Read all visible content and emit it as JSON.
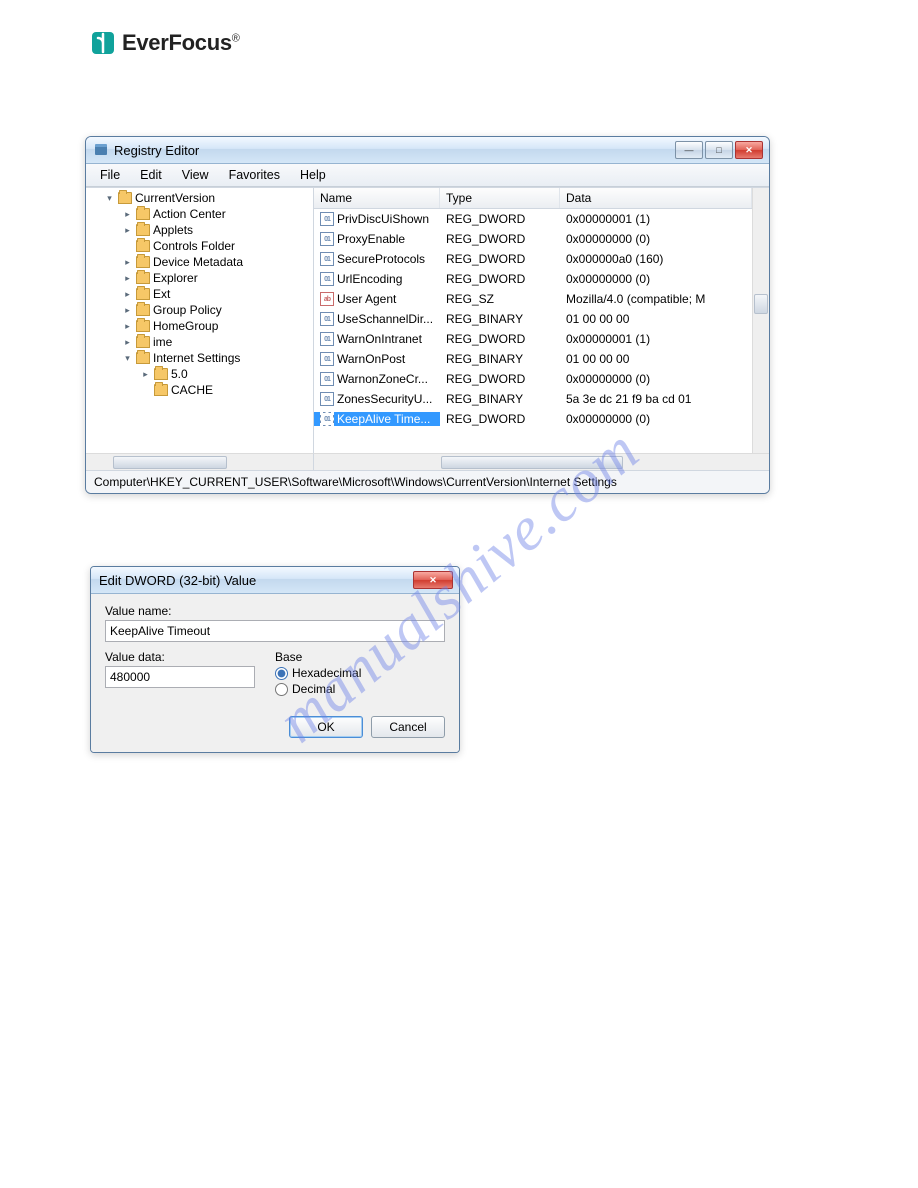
{
  "logo_text": "EverFocus",
  "watermark": "manualshive.com",
  "regedit": {
    "title": "Registry Editor",
    "menu": [
      "File",
      "Edit",
      "View",
      "Favorites",
      "Help"
    ],
    "status_path": "Computer\\HKEY_CURRENT_USER\\Software\\Microsoft\\Windows\\CurrentVersion\\Internet Settings",
    "tree": [
      {
        "indent": 0,
        "exp": "▾",
        "label": "CurrentVersion",
        "selected": false
      },
      {
        "indent": 1,
        "exp": "▸",
        "label": "Action Center"
      },
      {
        "indent": 1,
        "exp": "▸",
        "label": "Applets"
      },
      {
        "indent": 1,
        "exp": "",
        "label": "Controls Folder"
      },
      {
        "indent": 1,
        "exp": "▸",
        "label": "Device Metadata"
      },
      {
        "indent": 1,
        "exp": "▸",
        "label": "Explorer"
      },
      {
        "indent": 1,
        "exp": "▸",
        "label": "Ext"
      },
      {
        "indent": 1,
        "exp": "▸",
        "label": "Group Policy"
      },
      {
        "indent": 1,
        "exp": "▸",
        "label": "HomeGroup"
      },
      {
        "indent": 1,
        "exp": "▸",
        "label": "ime"
      },
      {
        "indent": 1,
        "exp": "▾",
        "label": "Internet Settings",
        "selected": true
      },
      {
        "indent": 2,
        "exp": "▸",
        "label": "5.0"
      },
      {
        "indent": 2,
        "exp": "",
        "label": "CACHE"
      }
    ],
    "cols": {
      "name": "Name",
      "type": "Type",
      "data": "Data"
    },
    "values": [
      {
        "name": "PrivDiscUiShown",
        "type": "REG_DWORD",
        "data": "0x00000001 (1)",
        "ic": "bin"
      },
      {
        "name": "ProxyEnable",
        "type": "REG_DWORD",
        "data": "0x00000000 (0)",
        "ic": "bin"
      },
      {
        "name": "SecureProtocols",
        "type": "REG_DWORD",
        "data": "0x000000a0 (160)",
        "ic": "bin"
      },
      {
        "name": "UrlEncoding",
        "type": "REG_DWORD",
        "data": "0x00000000 (0)",
        "ic": "bin"
      },
      {
        "name": "User Agent",
        "type": "REG_SZ",
        "data": "Mozilla/4.0 (compatible; M",
        "ic": "sz"
      },
      {
        "name": "UseSchannelDir...",
        "type": "REG_BINARY",
        "data": "01 00 00 00",
        "ic": "bin"
      },
      {
        "name": "WarnOnIntranet",
        "type": "REG_DWORD",
        "data": "0x00000001 (1)",
        "ic": "bin"
      },
      {
        "name": "WarnOnPost",
        "type": "REG_BINARY",
        "data": "01 00 00 00",
        "ic": "bin"
      },
      {
        "name": "WarnonZoneCr...",
        "type": "REG_DWORD",
        "data": "0x00000000 (0)",
        "ic": "bin"
      },
      {
        "name": "ZonesSecurityU...",
        "type": "REG_BINARY",
        "data": "5a 3e dc 21 f9 ba cd 01",
        "ic": "bin"
      },
      {
        "name": "KeepAlive Time...",
        "type": "REG_DWORD",
        "data": "0x00000000 (0)",
        "ic": "bin",
        "selected": true
      }
    ]
  },
  "dialog": {
    "title": "Edit DWORD (32-bit) Value",
    "value_name_label": "Value name:",
    "value_name": "KeepAlive Timeout",
    "value_data_label": "Value data:",
    "value_data": "480000",
    "base_label": "Base",
    "hex_label": "Hexadecimal",
    "dec_label": "Decimal",
    "ok": "OK",
    "cancel": "Cancel"
  }
}
